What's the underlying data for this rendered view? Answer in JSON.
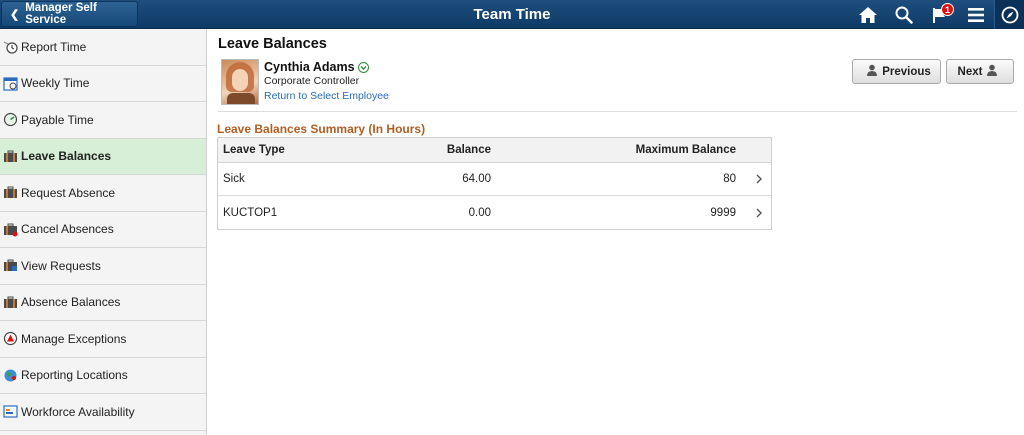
{
  "header": {
    "back_label": "Manager Self Service",
    "title": "Team Time",
    "notification_count": "1"
  },
  "sidebar": {
    "items": [
      {
        "label": "Report Time",
        "icon": "clock-icon"
      },
      {
        "label": "Weekly Time",
        "icon": "calendar-icon"
      },
      {
        "label": "Payable Time",
        "icon": "gauge-icon"
      },
      {
        "label": "Leave Balances",
        "icon": "briefcase-icon",
        "active": true
      },
      {
        "label": "Request Absence",
        "icon": "briefcase-icon"
      },
      {
        "label": "Cancel Absences",
        "icon": "briefcase-cancel-icon"
      },
      {
        "label": "View Requests",
        "icon": "briefcase-view-icon"
      },
      {
        "label": "Absence Balances",
        "icon": "briefcase-icon"
      },
      {
        "label": "Manage Exceptions",
        "icon": "warning-circle-icon"
      },
      {
        "label": "Reporting Locations",
        "icon": "globe-icon"
      },
      {
        "label": "Workforce Availability",
        "icon": "availability-icon"
      }
    ]
  },
  "main": {
    "page_title": "Leave Balances",
    "employee": {
      "name": "Cynthia Adams",
      "title": "Corporate Controller",
      "return_link": "Return to Select Employee"
    },
    "previous_label": "Previous",
    "next_label": "Next",
    "section_title": "Leave Balances Summary (In Hours)",
    "table": {
      "headers": [
        "Leave Type",
        "Balance",
        "Maximum Balance"
      ],
      "rows": [
        [
          "Sick",
          "64.00",
          "80"
        ],
        [
          "KUCTOP1",
          "0.00",
          "9999"
        ]
      ]
    }
  },
  "colors": {
    "banner": "#1a4573",
    "active_nav": "#d6efd6",
    "section_title": "#b35d20",
    "link": "#2a6bc0"
  }
}
